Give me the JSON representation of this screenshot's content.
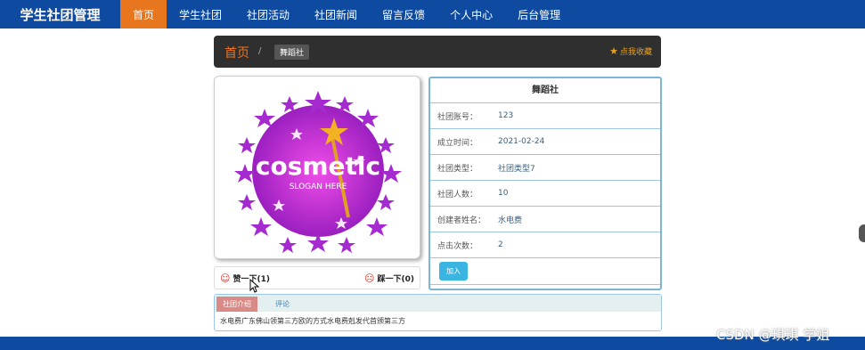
{
  "nav": {
    "brand": "学生社团管理",
    "items": [
      "首页",
      "学生社团",
      "社团活动",
      "社团新闻",
      "留言反馈",
      "个人中心",
      "后台管理"
    ]
  },
  "breadcrumb": {
    "home": "首页",
    "separator": "/",
    "current": "舞蹈社",
    "favorite": "点我收藏"
  },
  "logo": {
    "main": "cosmetic",
    "slogan": "SLOGAN HERE"
  },
  "vote": {
    "up": "赞一下(1)",
    "down": "踩一下(0)"
  },
  "info": {
    "title": "舞蹈社",
    "rows": [
      {
        "label": "社团账号：",
        "value": "123"
      },
      {
        "label": "成立时间：",
        "value": "2021-02-24"
      },
      {
        "label": "社团类型：",
        "value": "社团类型7"
      },
      {
        "label": "社团人数：",
        "value": "10"
      },
      {
        "label": "创建者姓名：",
        "value": "水电费"
      },
      {
        "label": "点击次数：",
        "value": "2"
      }
    ],
    "join": "加入"
  },
  "tabs": {
    "intro": "社团介绍",
    "comment": "评论",
    "content": "水电费广东佛山领第三方欧的方式水电费剋发代首颁第三方"
  },
  "watermark": "CSDN @琪琪 学姐",
  "colors": {
    "nav": "#0d4aa0",
    "active": "#e8761f",
    "crumb_bg": "#2f2f2f",
    "join": "#3ab4e0",
    "tab_active": "#d98a86"
  }
}
